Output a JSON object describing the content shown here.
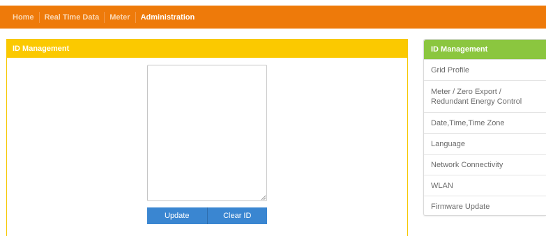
{
  "nav": {
    "items": [
      "Home",
      "Real Time Data",
      "Meter",
      "Administration"
    ],
    "active": "Administration"
  },
  "main": {
    "title": "ID Management",
    "textarea_value": "",
    "buttons": {
      "update": "Update",
      "clear": "Clear ID"
    }
  },
  "side": {
    "title": "ID Management",
    "items": [
      "Grid Profile",
      "Meter / Zero Export / Redundant Energy Control",
      "Date,Time,Time Zone",
      "Language",
      "Network Connectivity",
      "WLAN",
      "Firmware Update"
    ]
  },
  "colors": {
    "nav_bar": "#ee7a0a",
    "main_header": "#fbc900",
    "side_header": "#8bc63f",
    "button": "#3a86d1"
  }
}
